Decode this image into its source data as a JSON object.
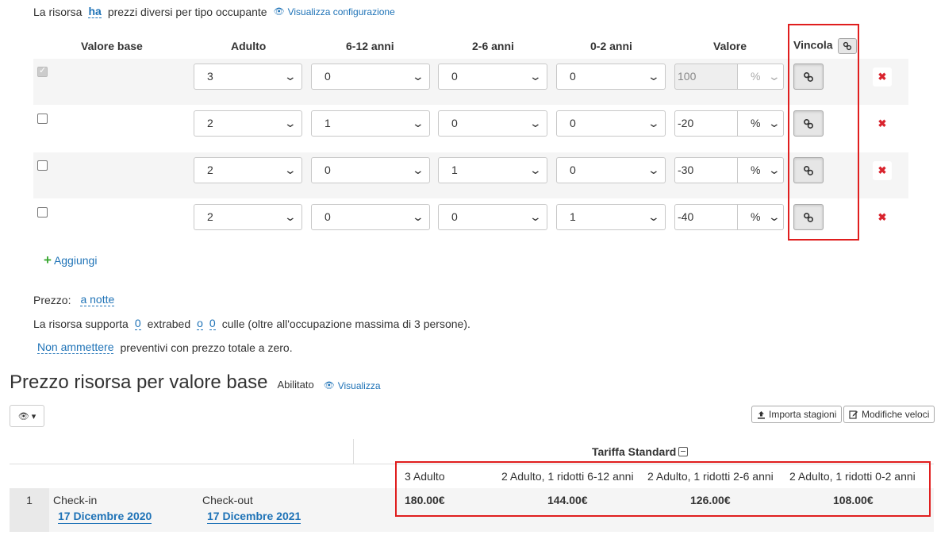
{
  "top": {
    "prefix": "La risorsa",
    "ha": "ha",
    "suffix": "prezzi diversi per tipo occupante",
    "view_config": "Visualizza configurazione"
  },
  "table": {
    "headers": {
      "base": "Valore base",
      "adulto": "Adulto",
      "c612": "6-12 anni",
      "c26": "2-6 anni",
      "c02": "0-2 anni",
      "valore": "Valore",
      "vincola": "Vincola"
    },
    "rows": [
      {
        "checked": true,
        "disabled": true,
        "adulto": "3",
        "c612": "0",
        "c26": "0",
        "c02": "0",
        "value": "100",
        "unit": "%"
      },
      {
        "checked": false,
        "disabled": false,
        "adulto": "2",
        "c612": "1",
        "c26": "0",
        "c02": "0",
        "value": "-20",
        "unit": "%"
      },
      {
        "checked": false,
        "disabled": false,
        "adulto": "2",
        "c612": "0",
        "c26": "1",
        "c02": "0",
        "value": "-30",
        "unit": "%"
      },
      {
        "checked": false,
        "disabled": false,
        "adulto": "2",
        "c612": "0",
        "c26": "0",
        "c02": "1",
        "value": "-40",
        "unit": "%"
      }
    ]
  },
  "add_label": "Aggiungi",
  "prezzo": {
    "label": "Prezzo:",
    "value": "a notte"
  },
  "supporta": {
    "p1": "La risorsa supporta",
    "extrabed": "0",
    "p2": "extrabed",
    "o": "o",
    "culle": "0",
    "p3": "culle (oltre all'occupazione massima di 3 persone)."
  },
  "ammettere": {
    "link": "Non ammettere",
    "text": "preventivi con prezzo totale a zero."
  },
  "section": {
    "title": "Prezzo risorsa per valore base",
    "status": "Abilitato",
    "view": "Visualizza"
  },
  "buttons": {
    "importa": "Importa stagioni",
    "modifiche": "Modifiche veloci"
  },
  "pricing": {
    "tariff": "Tariffa Standard",
    "columns": [
      "3 Adulto",
      "2 Adulto, 1 ridotti 6-12 anni",
      "2 Adulto, 1 ridotti 2-6 anni",
      "2 Adulto, 1 ridotti 0-2 anni"
    ],
    "row": {
      "num": "1",
      "checkin_label": "Check-in",
      "checkin_date": "17 Dicembre 2020",
      "checkout_label": "Check-out",
      "checkout_date": "17 Dicembre 2021",
      "prices": [
        "180.00€",
        "144.00€",
        "126.00€",
        "108.00€"
      ]
    }
  },
  "colors": {
    "accent": "#1f73b7",
    "highlight": "#e01e1e",
    "delete": "#d9232d",
    "add": "#3aa832"
  }
}
